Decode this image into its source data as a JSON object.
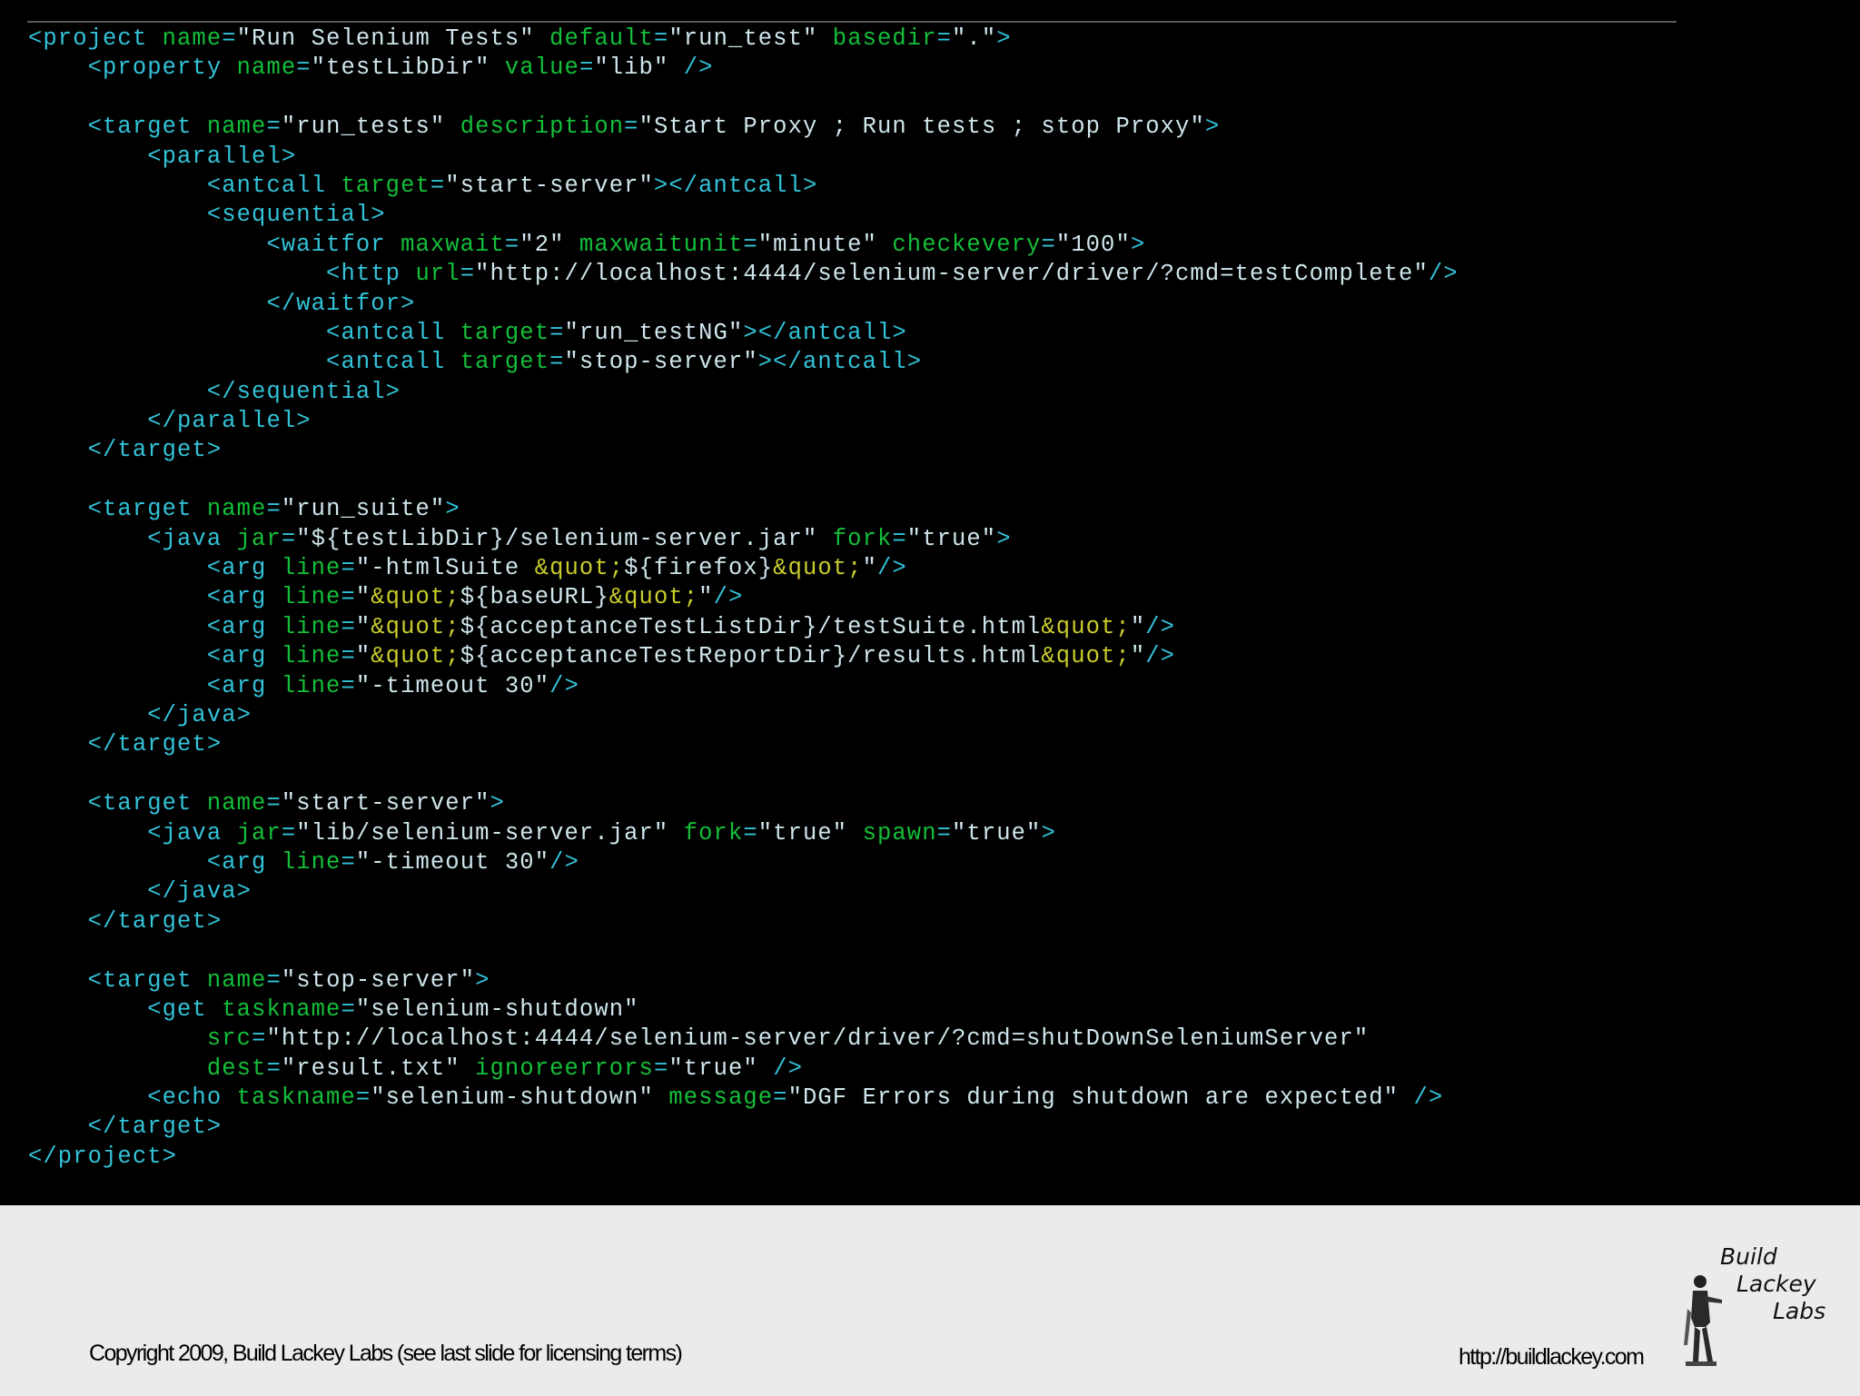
{
  "code_lines": [
    [
      [
        "tag",
        "<project "
      ],
      [
        "attr",
        "name"
      ],
      [
        "tag",
        "="
      ],
      [
        "str",
        "\"Run Selenium Tests\""
      ],
      [
        "tag",
        " "
      ],
      [
        "attr",
        "default"
      ],
      [
        "tag",
        "="
      ],
      [
        "str",
        "\"run_test\""
      ],
      [
        "tag",
        " "
      ],
      [
        "attr",
        "basedir"
      ],
      [
        "tag",
        "="
      ],
      [
        "str",
        "\".\""
      ],
      [
        "tag",
        ">"
      ]
    ],
    [
      [
        "tag",
        "    <property "
      ],
      [
        "attr",
        "name"
      ],
      [
        "tag",
        "="
      ],
      [
        "str",
        "\"testLibDir\""
      ],
      [
        "tag",
        " "
      ],
      [
        "attr",
        "value"
      ],
      [
        "tag",
        "="
      ],
      [
        "str",
        "\"lib\""
      ],
      [
        "tag",
        " />"
      ]
    ],
    [],
    [
      [
        "tag",
        "    <target "
      ],
      [
        "attr",
        "name"
      ],
      [
        "tag",
        "="
      ],
      [
        "str",
        "\"run_tests\""
      ],
      [
        "tag",
        " "
      ],
      [
        "attr",
        "description"
      ],
      [
        "tag",
        "="
      ],
      [
        "str",
        "\"Start Proxy ; Run tests ; stop Proxy\""
      ],
      [
        "tag",
        ">"
      ]
    ],
    [
      [
        "tag",
        "        <parallel>"
      ]
    ],
    [
      [
        "tag",
        "            <antcall "
      ],
      [
        "attr",
        "target"
      ],
      [
        "tag",
        "="
      ],
      [
        "str",
        "\"start-server\""
      ],
      [
        "tag",
        "></antcall>"
      ]
    ],
    [
      [
        "tag",
        "            <sequential>"
      ]
    ],
    [
      [
        "tag",
        "                <waitfor "
      ],
      [
        "attr",
        "maxwait"
      ],
      [
        "tag",
        "="
      ],
      [
        "str",
        "\"2\""
      ],
      [
        "tag",
        " "
      ],
      [
        "attr",
        "maxwaitunit"
      ],
      [
        "tag",
        "="
      ],
      [
        "str",
        "\"minute\""
      ],
      [
        "tag",
        " "
      ],
      [
        "attr",
        "checkevery"
      ],
      [
        "tag",
        "="
      ],
      [
        "str",
        "\"100\""
      ],
      [
        "tag",
        ">"
      ]
    ],
    [
      [
        "tag",
        "                    <http "
      ],
      [
        "attr",
        "url"
      ],
      [
        "tag",
        "="
      ],
      [
        "str",
        "\"http://localhost:4444/selenium-server/driver/?cmd=testComplete\""
      ],
      [
        "tag",
        "/>"
      ]
    ],
    [
      [
        "tag",
        "                </waitfor>"
      ]
    ],
    [
      [
        "tag",
        "                    <antcall "
      ],
      [
        "attr",
        "target"
      ],
      [
        "tag",
        "="
      ],
      [
        "str",
        "\"run_testNG\""
      ],
      [
        "tag",
        "></antcall>"
      ]
    ],
    [
      [
        "tag",
        "                    <antcall "
      ],
      [
        "attr",
        "target"
      ],
      [
        "tag",
        "="
      ],
      [
        "str",
        "\"stop-server\""
      ],
      [
        "tag",
        "></antcall>"
      ]
    ],
    [
      [
        "tag",
        "            </sequential>"
      ]
    ],
    [
      [
        "tag",
        "        </parallel>"
      ]
    ],
    [
      [
        "tag",
        "    </target>"
      ]
    ],
    [],
    [
      [
        "tag",
        "    <target "
      ],
      [
        "attr",
        "name"
      ],
      [
        "tag",
        "="
      ],
      [
        "str",
        "\"run_suite\""
      ],
      [
        "tag",
        ">"
      ]
    ],
    [
      [
        "tag",
        "        <java "
      ],
      [
        "attr",
        "jar"
      ],
      [
        "tag",
        "="
      ],
      [
        "str",
        "\"${testLibDir}/selenium-server.jar\""
      ],
      [
        "tag",
        " "
      ],
      [
        "attr",
        "fork"
      ],
      [
        "tag",
        "="
      ],
      [
        "str",
        "\"true\""
      ],
      [
        "tag",
        ">"
      ]
    ],
    [
      [
        "tag",
        "            <arg "
      ],
      [
        "attr",
        "line"
      ],
      [
        "tag",
        "="
      ],
      [
        "str",
        "\"-htmlSuite "
      ],
      [
        "ent",
        "&quot;"
      ],
      [
        "str",
        "${firefox}"
      ],
      [
        "ent",
        "&quot;"
      ],
      [
        "str",
        "\""
      ],
      [
        "tag",
        "/>"
      ]
    ],
    [
      [
        "tag",
        "            <arg "
      ],
      [
        "attr",
        "line"
      ],
      [
        "tag",
        "="
      ],
      [
        "str",
        "\""
      ],
      [
        "ent",
        "&quot;"
      ],
      [
        "str",
        "${baseURL}"
      ],
      [
        "ent",
        "&quot;"
      ],
      [
        "str",
        "\""
      ],
      [
        "tag",
        "/>"
      ]
    ],
    [
      [
        "tag",
        "            <arg "
      ],
      [
        "attr",
        "line"
      ],
      [
        "tag",
        "="
      ],
      [
        "str",
        "\""
      ],
      [
        "ent",
        "&quot;"
      ],
      [
        "str",
        "${acceptanceTestListDir}/testSuite.html"
      ],
      [
        "ent",
        "&quot;"
      ],
      [
        "str",
        "\""
      ],
      [
        "tag",
        "/>"
      ]
    ],
    [
      [
        "tag",
        "            <arg "
      ],
      [
        "attr",
        "line"
      ],
      [
        "tag",
        "="
      ],
      [
        "str",
        "\""
      ],
      [
        "ent",
        "&quot;"
      ],
      [
        "str",
        "${acceptanceTestReportDir}/results.html"
      ],
      [
        "ent",
        "&quot;"
      ],
      [
        "str",
        "\""
      ],
      [
        "tag",
        "/>"
      ]
    ],
    [
      [
        "tag",
        "            <arg "
      ],
      [
        "attr",
        "line"
      ],
      [
        "tag",
        "="
      ],
      [
        "str",
        "\"-timeout 30\""
      ],
      [
        "tag",
        "/>"
      ]
    ],
    [
      [
        "tag",
        "        </java>"
      ]
    ],
    [
      [
        "tag",
        "    </target>"
      ]
    ],
    [],
    [
      [
        "tag",
        "    <target "
      ],
      [
        "attr",
        "name"
      ],
      [
        "tag",
        "="
      ],
      [
        "str",
        "\"start-server\""
      ],
      [
        "tag",
        ">"
      ]
    ],
    [
      [
        "tag",
        "        <java "
      ],
      [
        "attr",
        "jar"
      ],
      [
        "tag",
        "="
      ],
      [
        "str",
        "\"lib/selenium-server.jar\""
      ],
      [
        "tag",
        " "
      ],
      [
        "attr",
        "fork"
      ],
      [
        "tag",
        "="
      ],
      [
        "str",
        "\"true\""
      ],
      [
        "tag",
        " "
      ],
      [
        "attr",
        "spawn"
      ],
      [
        "tag",
        "="
      ],
      [
        "str",
        "\"true\""
      ],
      [
        "tag",
        ">"
      ]
    ],
    [
      [
        "tag",
        "            <arg "
      ],
      [
        "attr",
        "line"
      ],
      [
        "tag",
        "="
      ],
      [
        "str",
        "\"-timeout 30\""
      ],
      [
        "tag",
        "/>"
      ]
    ],
    [
      [
        "tag",
        "        </java>"
      ]
    ],
    [
      [
        "tag",
        "    </target>"
      ]
    ],
    [],
    [
      [
        "tag",
        "    <target "
      ],
      [
        "attr",
        "name"
      ],
      [
        "tag",
        "="
      ],
      [
        "str",
        "\"stop-server\""
      ],
      [
        "tag",
        ">"
      ]
    ],
    [
      [
        "tag",
        "        <get "
      ],
      [
        "attr",
        "taskname"
      ],
      [
        "tag",
        "="
      ],
      [
        "str",
        "\"selenium-shutdown\""
      ]
    ],
    [
      [
        "tag",
        "            "
      ],
      [
        "attr",
        "src"
      ],
      [
        "tag",
        "="
      ],
      [
        "str",
        "\"http://localhost:4444/selenium-server/driver/?cmd=shutDownSeleniumServer\""
      ]
    ],
    [
      [
        "tag",
        "            "
      ],
      [
        "attr",
        "dest"
      ],
      [
        "tag",
        "="
      ],
      [
        "str",
        "\"result.txt\""
      ],
      [
        "tag",
        " "
      ],
      [
        "attr",
        "ignoreerrors"
      ],
      [
        "tag",
        "="
      ],
      [
        "str",
        "\"true\""
      ],
      [
        "tag",
        " />"
      ]
    ],
    [
      [
        "tag",
        "        <echo "
      ],
      [
        "attr",
        "taskname"
      ],
      [
        "tag",
        "="
      ],
      [
        "str",
        "\"selenium-shutdown\""
      ],
      [
        "tag",
        " "
      ],
      [
        "attr",
        "message"
      ],
      [
        "tag",
        "="
      ],
      [
        "str",
        "\"DGF Errors during shutdown are expected\""
      ],
      [
        "tag",
        " />"
      ]
    ],
    [
      [
        "tag",
        "    </target>"
      ]
    ],
    [
      [
        "tag",
        "</project>"
      ]
    ]
  ],
  "footer": {
    "copyright": "Copyright 2009, Build Lackey Labs  (see last slide for licensing terms)",
    "url": "http://buildlackey.com",
    "logo_words": [
      "Build",
      "Lackey",
      "Labs"
    ]
  }
}
